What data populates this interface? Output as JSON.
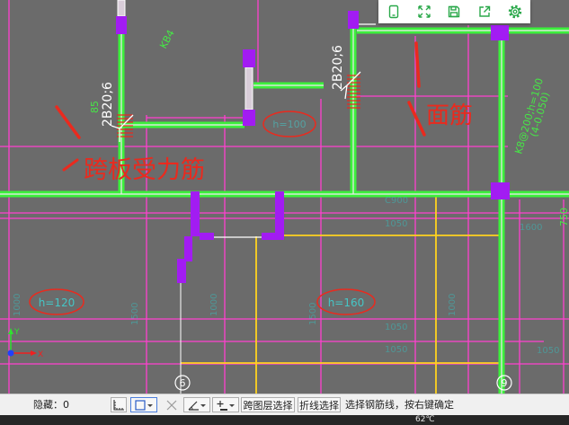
{
  "toolbar": {
    "icons": [
      "tablet-icon",
      "expand-icon",
      "save-icon",
      "share-icon",
      "settings-icon"
    ]
  },
  "colors": {
    "canvas_bg": "#6b6b6b",
    "beam": "#3cf03c",
    "cad_line": "#ff40d0",
    "column": "#a21cf2",
    "slab_line": "#ffd21e",
    "annotation": "#ea2a1e",
    "icon": "#2aa84a"
  },
  "drawing": {
    "annotations": {
      "span_slab_rebar": "跨板受力筋",
      "top_rebar": "面筋"
    },
    "rebar_labels": [
      "2B20;6",
      "2B20;6"
    ],
    "rebar_label_small": "85",
    "beam_label": "KB4",
    "slab_spec": "K8@200;h=100",
    "slab_elevation": "(4-0.050)",
    "slab_thickness": [
      "h=100",
      "h=120",
      "h=160"
    ],
    "dimensions": [
      "1000",
      "1500",
      "1000",
      "1500",
      "1000",
      "C900",
      "1050",
      "1050",
      "1050",
      "1050",
      "1600",
      "750"
    ],
    "axis_labels": [
      "6",
      "9"
    ],
    "coordinate_axes": {
      "y": "Y",
      "x": "X"
    }
  },
  "statusbar": {
    "hidden_label": "隐藏：0",
    "cross_layer_select": "跨图层选择",
    "polyline_select": "折线选择",
    "hint": "选择钢筋线，按右键确定"
  },
  "taskbar": {
    "temperature": "62℃"
  }
}
